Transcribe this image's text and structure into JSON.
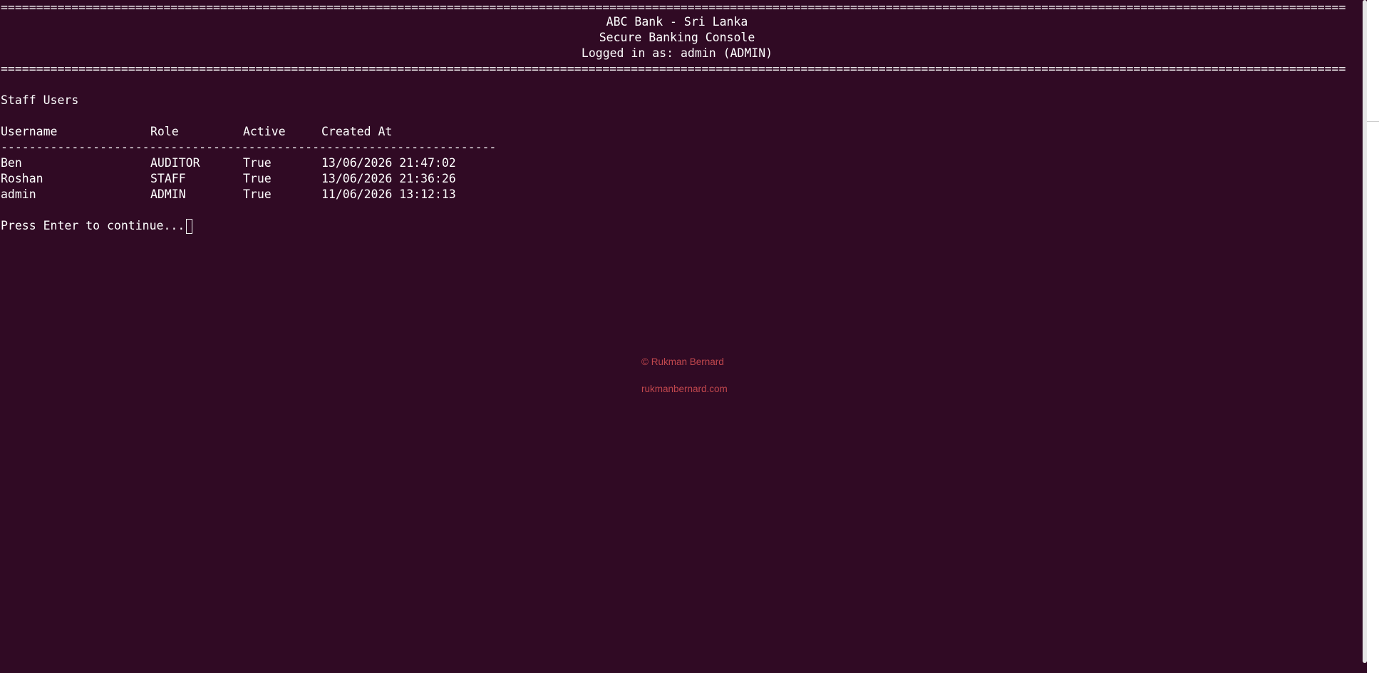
{
  "terminal": {
    "rule_char": "=",
    "header": {
      "line1": "ABC Bank - Sri Lanka",
      "line2": "Secure Banking Console",
      "line3": "Logged in as: admin (ADMIN)"
    },
    "section_title": "Staff Users",
    "table": {
      "columns": [
        "Username",
        "Role",
        "Active",
        "Created At"
      ],
      "divider_char": "-",
      "rows": [
        {
          "username": "Ben",
          "role": "AUDITOR",
          "active": "True",
          "created_at": "13/06/2026 21:47:02"
        },
        {
          "username": "Roshan",
          "role": "STAFF",
          "active": "True",
          "created_at": "13/06/2026 21:36:26"
        },
        {
          "username": "admin",
          "role": "ADMIN",
          "active": "True",
          "created_at": "11/06/2026 13:12:13"
        }
      ]
    },
    "prompt": "Press Enter to continue..."
  },
  "watermark": {
    "copyright": "© Rukman Bernard",
    "website": "rukmanbernard.com"
  },
  "colors": {
    "background": "#300a24",
    "text": "#f2f2f2",
    "watermark": "#c0474d"
  }
}
